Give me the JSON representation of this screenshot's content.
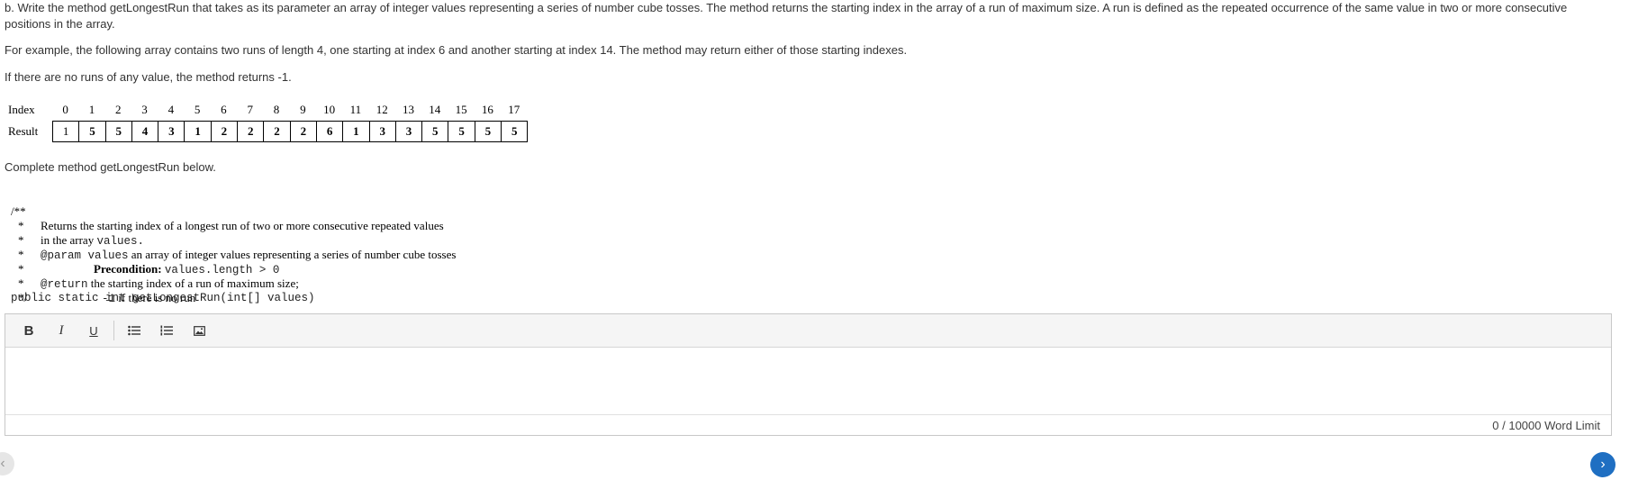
{
  "question": {
    "intro": "b. Write the method getLongestRun that takes as its parameter an array of integer values representing a series of number cube tosses. The method returns the starting index in the array of a run of maximum size. A run is defined as the repeated occurrence of the same value in two or more consecutive positions in the array.",
    "example": "For example, the following array contains two runs of length 4, one starting at index 6 and another starting at index 14. The method may return either of those starting indexes.",
    "no_runs": "If there are no runs of any value, the method returns -1.",
    "complete": "Complete method getLongestRun below."
  },
  "run_table": {
    "index_label": "Index",
    "result_label": "Result",
    "indices": [
      "0",
      "1",
      "2",
      "3",
      "4",
      "5",
      "6",
      "7",
      "8",
      "9",
      "10",
      "11",
      "12",
      "13",
      "14",
      "15",
      "16",
      "17"
    ],
    "results": [
      "1",
      "5",
      "5",
      "4",
      "3",
      "1",
      "2",
      "2",
      "2",
      "2",
      "6",
      "1",
      "3",
      "3",
      "5",
      "5",
      "5",
      "5"
    ]
  },
  "code": {
    "l1_star": "/**",
    "l1_text": "Returns the starting index of a longest run of two or more consecutive repeated values",
    "l2_star": "*",
    "l2_text": "in the array",
    "l2_mono": "values.",
    "l3_star": "*",
    "l3_tag": "@param values",
    "l3_text": "an array of integer values representing a series of number cube tosses",
    "l4_star": "*",
    "l4_bold": "Precondition:",
    "l4_mono": "values.length > 0",
    "l5_star": "*",
    "l5_tag": "@return",
    "l5_text": "the starting index of a run of maximum size;",
    "l6_star": "*",
    "l6_mono": "-1",
    "l6_text": "if there is no run",
    "l7_star": "*/",
    "signature": "public static int getLongestRun(int[] values)"
  },
  "editor": {
    "bold": "B",
    "italic": "I",
    "underline": "U",
    "word_count": "0 / 10000 Word Limit"
  },
  "nav": {
    "prev_icon": "chevron-left-icon",
    "next_icon": "chevron-right-icon",
    "next_color": "#1f6fc2"
  }
}
